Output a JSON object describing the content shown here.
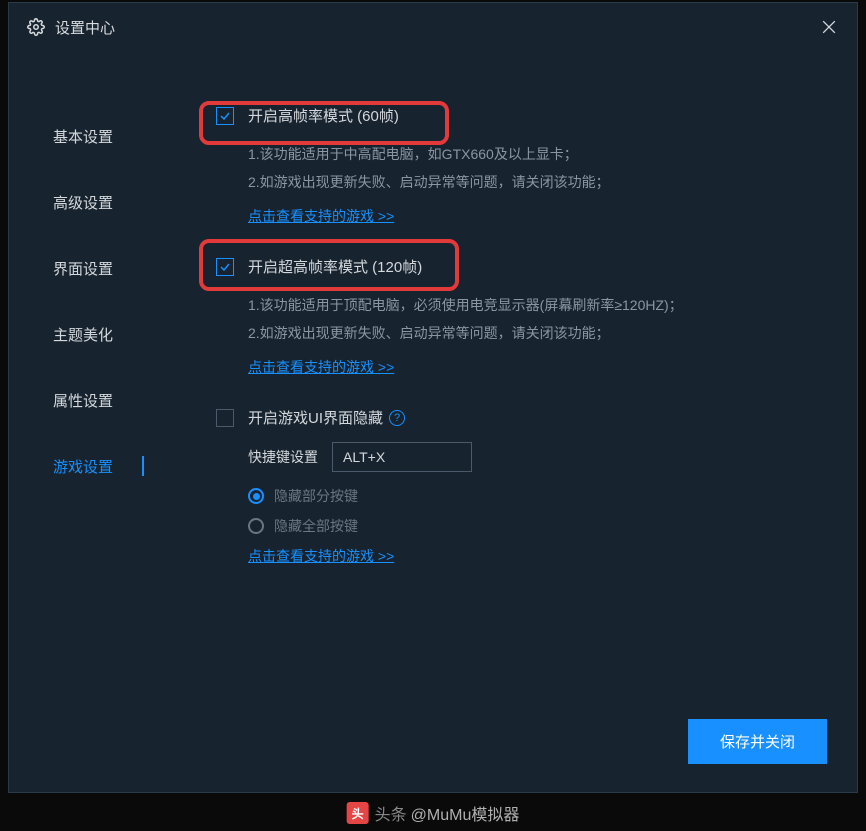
{
  "title": "设置中心",
  "sidebar": {
    "items": [
      {
        "label": "基本设置"
      },
      {
        "label": "高级设置"
      },
      {
        "label": "界面设置"
      },
      {
        "label": "主题美化"
      },
      {
        "label": "属性设置"
      },
      {
        "label": "游戏设置"
      }
    ]
  },
  "section1": {
    "checkbox_label": "开启高帧率模式 (60帧)",
    "desc1": "1.该功能适用于中高配电脑，如GTX660及以上显卡；",
    "desc2": "2.如游戏出现更新失败、启动异常等问题，请关闭该功能；",
    "link": "点击查看支持的游戏 >>"
  },
  "section2": {
    "checkbox_label": "开启超高帧率模式 (120帧)",
    "desc1": "1.该功能适用于顶配电脑，必须使用电竞显示器(屏幕刷新率≥120HZ)；",
    "desc2": "2.如游戏出现更新失败、启动异常等问题，请关闭该功能；",
    "link": "点击查看支持的游戏 >>"
  },
  "section3": {
    "checkbox_label": "开启游戏UI界面隐藏",
    "hotkey_label": "快捷键设置",
    "hotkey_value": "ALT+X",
    "radio1": "隐藏部分按键",
    "radio2": "隐藏全部按键",
    "link": "点击查看支持的游戏 >>"
  },
  "save_button": "保存并关闭",
  "watermark": {
    "prefix": "头条",
    "handle": "@MuMu模拟器"
  }
}
